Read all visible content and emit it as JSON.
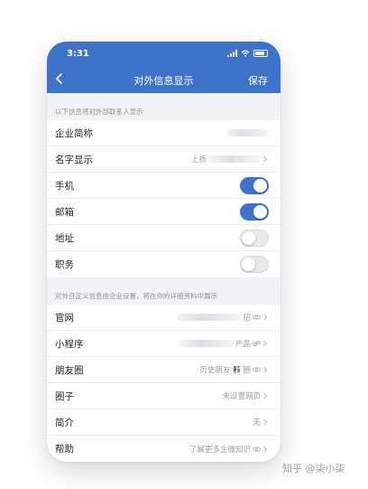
{
  "status_bar": {
    "time": "3:31"
  },
  "nav": {
    "title": "对外信息显示",
    "save_label": "保存"
  },
  "section1": {
    "caption": "以下信息将对外部联系人显示",
    "rows": [
      {
        "label": "企业简称",
        "value": ""
      },
      {
        "label": "名字显示",
        "value": "上扬"
      },
      {
        "label": "手机",
        "toggle": "on"
      },
      {
        "label": "邮箱",
        "toggle": "on"
      },
      {
        "label": "地址",
        "toggle": "off"
      },
      {
        "label": "职务",
        "toggle": "off"
      }
    ]
  },
  "section2": {
    "caption": "对外自定义信息由企业设置，将在你的详细资料中展示",
    "rows": [
      {
        "label": "官网",
        "value": "招"
      },
      {
        "label": "小程序",
        "value": "产品"
      },
      {
        "label": "朋友圈",
        "value_before": "历史朋友",
        "value_glyph": "👫",
        "value_after": "圈"
      },
      {
        "label": "圈子",
        "value": "未设置网页"
      },
      {
        "label": "简介",
        "value": "无"
      },
      {
        "label": "帮助",
        "value": "了解更多企微知识"
      }
    ]
  },
  "watermark": "知乎 @柒小柒",
  "colors": {
    "accent": "#3f73c9",
    "background": "#f2f3f7"
  }
}
